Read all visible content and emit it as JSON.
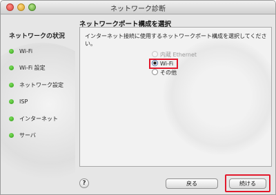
{
  "window": {
    "title": "ネットワーク診断"
  },
  "sidebar": {
    "heading": "ネットワークの状況",
    "steps": [
      {
        "label": "Wi-Fi",
        "status": "green"
      },
      {
        "label": "Wi-Fi 設定",
        "status": "green"
      },
      {
        "label": "ネットワーク設定",
        "status": "green"
      },
      {
        "label": "ISP",
        "status": "green"
      },
      {
        "label": "インターネット",
        "status": "green"
      },
      {
        "label": "サーバ",
        "status": "green"
      }
    ]
  },
  "main": {
    "title": "ネットワークポート構成を選択",
    "description": "インターネット接続に使用するネットワークポート構成を選択してください。",
    "options": [
      {
        "label": "内蔵 Ethernet",
        "selected": false,
        "disabled": true
      },
      {
        "label": "Wi-Fi",
        "selected": true,
        "disabled": false
      },
      {
        "label": "その他",
        "selected": false,
        "disabled": false
      }
    ]
  },
  "footer": {
    "help_label": "?",
    "back_label": "戻る",
    "continue_label": "続ける"
  },
  "colors": {
    "highlight": "#e2182b",
    "status_green": "#3aa81f"
  }
}
